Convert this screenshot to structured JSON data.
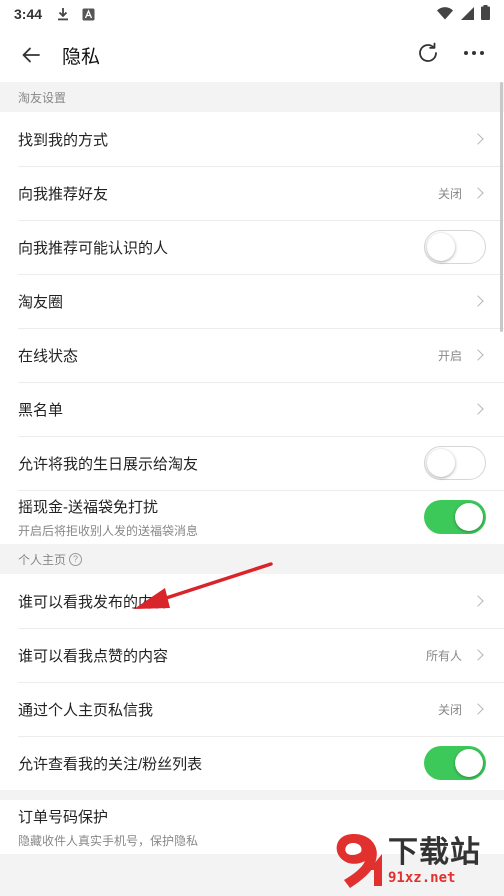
{
  "status_bar": {
    "time": "3:44",
    "icons": [
      "download-icon",
      "a-notification-icon",
      "wifi-icon",
      "signal-icon",
      "battery-icon"
    ]
  },
  "header": {
    "title": "隐私",
    "icons": [
      "back-arrow-icon",
      "refresh-icon",
      "more-icon"
    ]
  },
  "sections": [
    {
      "label": "淘友设置",
      "rows": [
        {
          "label": "找到我的方式",
          "kind": "link",
          "value": ""
        },
        {
          "label": "向我推荐好友",
          "kind": "link",
          "value": "关闭"
        },
        {
          "label": "向我推荐可能认识的人",
          "kind": "toggle",
          "on": false
        },
        {
          "label": "淘友圈",
          "kind": "link",
          "value": ""
        },
        {
          "label": "在线状态",
          "kind": "link",
          "value": "开启"
        },
        {
          "label": "黑名单",
          "kind": "link",
          "value": ""
        },
        {
          "label": "允许将我的生日展示给淘友",
          "kind": "toggle",
          "on": false
        },
        {
          "label": "摇现金-送福袋免打扰",
          "sub": "开启后将拒收别人发的送福袋消息",
          "kind": "toggle",
          "on": true
        }
      ]
    },
    {
      "label": "个人主页",
      "help_icon": "question-circle-icon",
      "rows": [
        {
          "label": "谁可以看我发布的内容",
          "kind": "link",
          "value": ""
        },
        {
          "label": "谁可以看我点赞的内容",
          "kind": "link",
          "value": "所有人"
        },
        {
          "label": "通过个人主页私信我",
          "kind": "link",
          "value": "关闭"
        },
        {
          "label": "允许查看我的关注/粉丝列表",
          "kind": "toggle",
          "on": true
        }
      ]
    },
    {
      "label": "",
      "rows": [
        {
          "label": "订单号码保护",
          "sub": "隐藏收件人真实手机号，保护隐私",
          "kind": "plain"
        }
      ]
    }
  ],
  "colors": {
    "toggle_on": "#3dc95a",
    "annotation_arrow": "#d9242a",
    "watermark_red": "#e0312f"
  },
  "watermark": {
    "big": "下载站",
    "url": "91xz.net"
  }
}
